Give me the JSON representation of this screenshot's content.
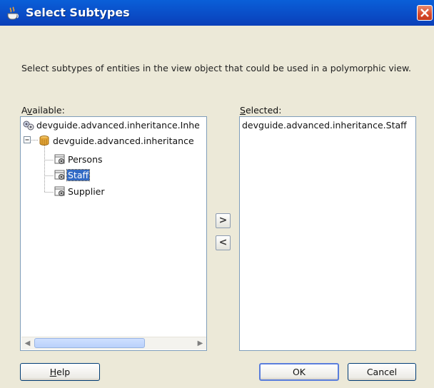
{
  "dialog": {
    "title": "Select Subtypes",
    "description": "Select subtypes of entities in the view object that could be used in a polymorphic view."
  },
  "available": {
    "label_pre": "A",
    "label_mnemonic": "v",
    "label_post": "ailable:",
    "root_item": "devguide.advanced.inheritance.Inhe",
    "package_item": "devguide.advanced.inheritance",
    "children": [
      "Persons",
      "Staff",
      "Supplier"
    ],
    "selected_child": "Staff"
  },
  "selected": {
    "label_mnemonic": "S",
    "label_post": "elected:",
    "items": [
      "devguide.advanced.inheritance.Staff"
    ]
  },
  "buttons": {
    "move_right": ">",
    "move_left": "<",
    "help_mnemonic": "H",
    "help_post": "elp",
    "ok": "OK",
    "cancel": "Cancel"
  },
  "colors": {
    "title_bar": "#0a4fc9",
    "selection": "#316ac5",
    "dialog_bg": "#ece9d8"
  },
  "icons": {
    "title": "cup-icon",
    "close": "close-icon",
    "root": "view-object-icon",
    "package": "package-icon",
    "entity": "entity-icon"
  }
}
